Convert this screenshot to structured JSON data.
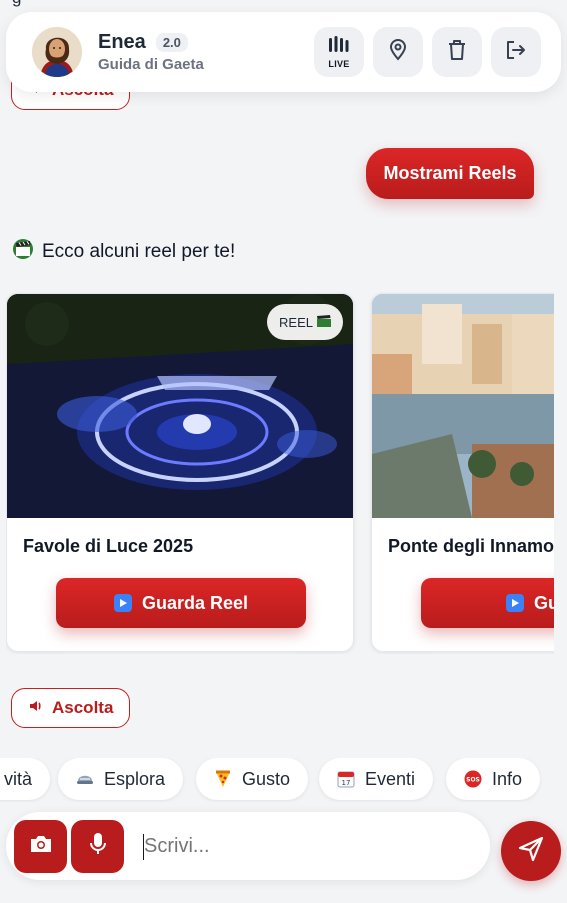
{
  "header": {
    "app_name": "Enea",
    "version": "2.0",
    "subtitle": "Guida di Gaeta",
    "live_label": "LIVE",
    "icons": [
      "live-bars-icon",
      "map-pin-icon",
      "trash-icon",
      "logout-icon"
    ]
  },
  "chat": {
    "ghost_text": "g",
    "ascolta_top_label": "Ascolta",
    "user_message": "Mostrami Reels",
    "bot_message": "Ecco alcuni reel per te!",
    "reels": [
      {
        "badge": "REEL",
        "title": "Favole di Luce 2025",
        "button": "Guarda Reel"
      },
      {
        "title": "Ponte degli Innamo",
        "button": "Guarc"
      }
    ],
    "ascolta_label": "Ascolta"
  },
  "chips": [
    {
      "label": "vità"
    },
    {
      "label": "Esplora"
    },
    {
      "label": "Gusto"
    },
    {
      "label": "Eventi"
    },
    {
      "label": "Info"
    }
  ],
  "composer": {
    "placeholder": "Scrivi..."
  },
  "colors": {
    "accent": "#b91c1c",
    "background": "#f3f4f6"
  }
}
